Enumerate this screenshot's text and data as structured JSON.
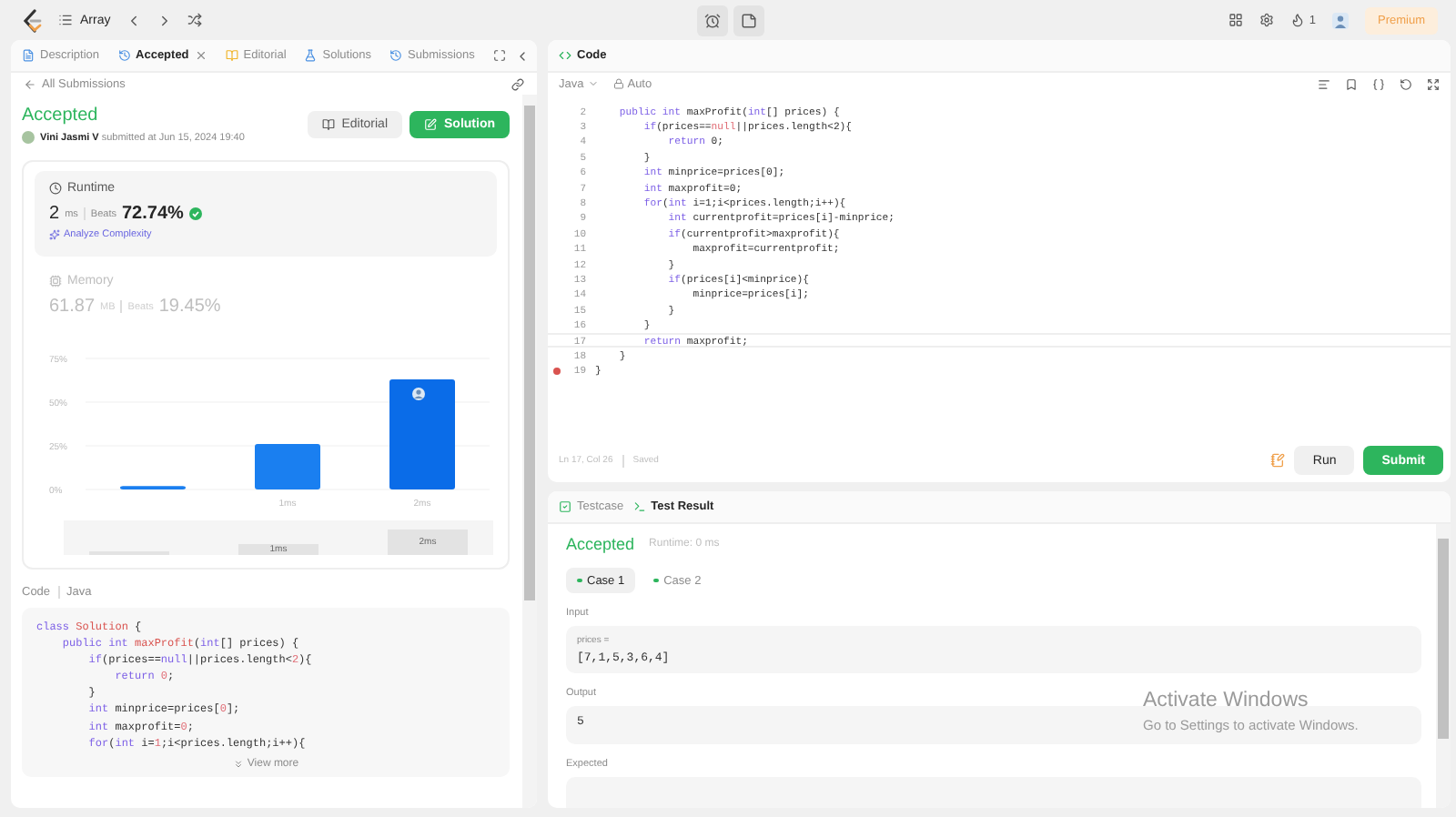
{
  "top_bar": {
    "problem_list": "Array",
    "streak": "1",
    "premium": "Premium"
  },
  "left_panel": {
    "tabs": [
      {
        "label": "Description",
        "kind": "description",
        "selected": false,
        "closable": false
      },
      {
        "label": "Accepted",
        "kind": "result",
        "selected": true,
        "closable": true
      },
      {
        "label": "Editorial",
        "kind": "editorial",
        "selected": false,
        "closable": false
      },
      {
        "label": "Solutions",
        "kind": "solutions",
        "selected": false,
        "closable": false
      },
      {
        "label": "Submissions",
        "kind": "submissions",
        "selected": false,
        "closable": false
      }
    ],
    "back_link": "All Submissions",
    "submission": {
      "status": "Accepted",
      "author": "Vini Jasmi V",
      "submitted": "submitted at Jun 15, 2024 19:40"
    },
    "buttons": [
      {
        "label": "Editorial",
        "primary": false
      },
      {
        "label": "Solution",
        "primary": true
      }
    ],
    "runtime": {
      "label": "Runtime",
      "value": "2",
      "unit": "ms",
      "beats_label": "Beats",
      "beats": "72.74%",
      "link": "Analyze Complexity",
      "selected": true
    },
    "memory": {
      "label": "Memory",
      "value": "61.87",
      "unit": "MB",
      "beats_label": "Beats",
      "beats": "19.45%",
      "selected": false
    },
    "chart_data": {
      "type": "bar",
      "categories": [
        null,
        "1ms",
        "2ms"
      ],
      "values": [
        2,
        26,
        63
      ],
      "ylim": [
        0,
        75
      ],
      "yticks": [
        {
          "value": 0,
          "label": "0%"
        },
        {
          "value": 25,
          "label": "25%"
        },
        {
          "value": 50,
          "label": "50%"
        },
        {
          "value": 75,
          "label": "75%"
        }
      ]
    },
    "range_labels": [
      "1ms",
      "2ms"
    ],
    "code_title": "Code",
    "code_language": "Java",
    "code_lines": [
      [
        {
          "text": "class",
          "kind": "k"
        },
        {
          "text": " Solution",
          "kind": "f"
        },
        {
          "text": " {",
          "kind": "p"
        }
      ],
      [
        {
          "text": "    public int",
          "kind": "k"
        },
        {
          "text": " maxProfit",
          "kind": "f"
        },
        {
          "text": "(",
          "kind": "p"
        },
        {
          "text": "int",
          "kind": "k"
        },
        {
          "text": "[] prices) {",
          "kind": "p"
        }
      ],
      [
        {
          "text": "        if",
          "kind": "k"
        },
        {
          "text": "(prices==",
          "kind": "p"
        },
        {
          "text": "null",
          "kind": "k"
        },
        {
          "text": "||prices.length<",
          "kind": "p"
        },
        {
          "text": "2",
          "kind": "n"
        },
        {
          "text": "){",
          "kind": "p"
        }
      ],
      [
        {
          "text": "            return",
          "kind": "k"
        },
        {
          "text": " 0",
          "kind": "n"
        },
        {
          "text": ";",
          "kind": "p"
        }
      ],
      [
        {
          "text": "        }",
          "kind": "p"
        }
      ],
      [
        {
          "text": "        int",
          "kind": "k"
        },
        {
          "text": " minprice=prices[",
          "kind": "p"
        },
        {
          "text": "0",
          "kind": "n"
        },
        {
          "text": "];",
          "kind": "p"
        }
      ],
      [
        {
          "text": "        int",
          "kind": "k"
        },
        {
          "text": " maxprofit=",
          "kind": "p"
        },
        {
          "text": "0",
          "kind": "n"
        },
        {
          "text": ";",
          "kind": "p"
        }
      ],
      [
        {
          "text": "        for",
          "kind": "k"
        },
        {
          "text": "(",
          "kind": "p"
        },
        {
          "text": "int",
          "kind": "k"
        },
        {
          "text": " i=",
          "kind": "p"
        },
        {
          "text": "1",
          "kind": "n"
        },
        {
          "text": ";i<prices.length;i++){",
          "kind": "p"
        }
      ]
    ],
    "view_more": "View more"
  },
  "right_panel": {
    "tab": "Code",
    "language": "Java",
    "mode": "Auto",
    "lines": [
      {
        "number": "2",
        "breakpoint": false,
        "current": false,
        "tokens": [
          {
            "text": "    public int",
            "kind": "k"
          },
          {
            "text": " maxProfit(",
            "kind": "p"
          },
          {
            "text": "int",
            "kind": "k"
          },
          {
            "text": "[] prices) {",
            "kind": "p"
          }
        ]
      },
      {
        "number": "3",
        "breakpoint": false,
        "current": false,
        "tokens": [
          {
            "text": "        if",
            "kind": "k"
          },
          {
            "text": "(prices==",
            "kind": "p"
          },
          {
            "text": "null",
            "kind": "n"
          },
          {
            "text": "||prices.length<2){",
            "kind": "p"
          }
        ]
      },
      {
        "number": "4",
        "breakpoint": false,
        "current": false,
        "tokens": [
          {
            "text": "            return",
            "kind": "k"
          },
          {
            "text": " 0;",
            "kind": "p"
          }
        ]
      },
      {
        "number": "5",
        "breakpoint": false,
        "current": false,
        "tokens": [
          {
            "text": "        }",
            "kind": "p"
          }
        ]
      },
      {
        "number": "6",
        "breakpoint": false,
        "current": false,
        "tokens": [
          {
            "text": "        int",
            "kind": "k"
          },
          {
            "text": " minprice=prices[0];",
            "kind": "p"
          }
        ]
      },
      {
        "number": "7",
        "breakpoint": false,
        "current": false,
        "tokens": [
          {
            "text": "        int",
            "kind": "k"
          },
          {
            "text": " maxprofit=0;",
            "kind": "p"
          }
        ]
      },
      {
        "number": "8",
        "breakpoint": false,
        "current": false,
        "tokens": [
          {
            "text": "        for",
            "kind": "k"
          },
          {
            "text": "(",
            "kind": "p"
          },
          {
            "text": "int",
            "kind": "k"
          },
          {
            "text": " i=1;i<prices.length;i++){",
            "kind": "p"
          }
        ]
      },
      {
        "number": "9",
        "breakpoint": false,
        "current": false,
        "tokens": [
          {
            "text": "            int",
            "kind": "k"
          },
          {
            "text": " currentprofit=prices[i]-minprice;",
            "kind": "p"
          }
        ]
      },
      {
        "number": "10",
        "breakpoint": false,
        "current": false,
        "tokens": [
          {
            "text": "            if",
            "kind": "k"
          },
          {
            "text": "(currentprofit>maxprofit){",
            "kind": "p"
          }
        ]
      },
      {
        "number": "11",
        "breakpoint": false,
        "current": false,
        "tokens": [
          {
            "text": "                maxprofit=currentprofit;",
            "kind": "p"
          }
        ]
      },
      {
        "number": "12",
        "breakpoint": false,
        "current": false,
        "tokens": [
          {
            "text": "            }",
            "kind": "p"
          }
        ]
      },
      {
        "number": "13",
        "breakpoint": false,
        "current": false,
        "tokens": [
          {
            "text": "            if",
            "kind": "k"
          },
          {
            "text": "(prices[i]<minprice){",
            "kind": "p"
          }
        ]
      },
      {
        "number": "14",
        "breakpoint": false,
        "current": false,
        "tokens": [
          {
            "text": "                minprice=prices[i];",
            "kind": "p"
          }
        ]
      },
      {
        "number": "15",
        "breakpoint": false,
        "current": false,
        "tokens": [
          {
            "text": "            }",
            "kind": "p"
          }
        ]
      },
      {
        "number": "16",
        "breakpoint": false,
        "current": false,
        "tokens": [
          {
            "text": "        }",
            "kind": "p"
          }
        ]
      },
      {
        "number": "17",
        "breakpoint": false,
        "current": true,
        "tokens": [
          {
            "text": "        return",
            "kind": "k"
          },
          {
            "text": " maxprofit;",
            "kind": "p"
          }
        ]
      },
      {
        "number": "18",
        "breakpoint": false,
        "current": false,
        "tokens": [
          {
            "text": "    }",
            "kind": "p"
          }
        ]
      },
      {
        "number": "19",
        "breakpoint": true,
        "current": false,
        "tokens": [
          {
            "text": "}",
            "kind": "p"
          }
        ]
      }
    ],
    "cursor": "Ln 17, Col 26",
    "saved": "Saved",
    "run": "Run",
    "submit": "Submit",
    "result_tabs": [
      {
        "label": "Testcase",
        "kind": "testcase",
        "selected": false
      },
      {
        "label": "Test Result",
        "kind": "result",
        "selected": true
      }
    ],
    "result": {
      "status": "Accepted",
      "runtime": "Runtime: 0 ms"
    },
    "cases": [
      {
        "label": "Case 1",
        "selected": true
      },
      {
        "label": "Case 2",
        "selected": false
      }
    ],
    "sections": [
      {
        "label": "Input",
        "param": "prices =",
        "value": "[7,1,5,3,6,4]"
      },
      {
        "label": "Output",
        "value": "5"
      },
      {
        "label": "Expected"
      }
    ]
  },
  "os_notice": {
    "title": "Activate Windows",
    "text": "Go to Settings to activate Windows."
  }
}
